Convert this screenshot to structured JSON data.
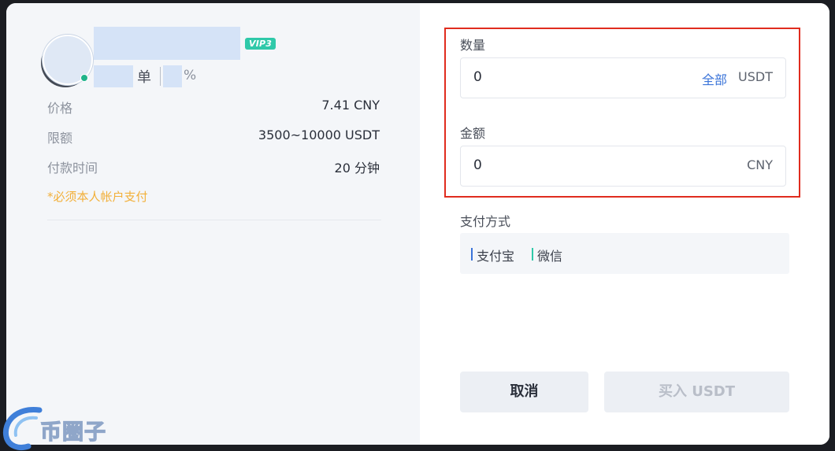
{
  "seller": {
    "vip_badge": "VIP3",
    "stat_unit": "单",
    "stat_pct": "%"
  },
  "details": {
    "price_label": "价格",
    "price_value": "7.41 CNY",
    "limit_label": "限额",
    "limit_value": "3500~10000 USDT",
    "time_label": "付款时间",
    "time_value": "20 分钟",
    "notice": "*必须本人帐户支付"
  },
  "form": {
    "quantity_label": "数量",
    "quantity_value": "0",
    "quantity_all": "全部",
    "quantity_unit": "USDT",
    "amount_label": "金额",
    "amount_value": "0",
    "amount_unit": "CNY"
  },
  "payment": {
    "title": "支付方式",
    "methods": [
      {
        "label": "支付宝",
        "color": "#3b74d9"
      },
      {
        "label": "微信",
        "color": "#2fc9a9"
      }
    ]
  },
  "buttons": {
    "cancel": "取消",
    "buy": "买入 USDT"
  },
  "watermark": {
    "text": "币圈子"
  },
  "colors": {
    "accent_blue": "#3b74d9",
    "vip_green": "#2fc9a9",
    "notice_yellow": "#f2b03a",
    "highlight_red": "#e02c1e"
  }
}
